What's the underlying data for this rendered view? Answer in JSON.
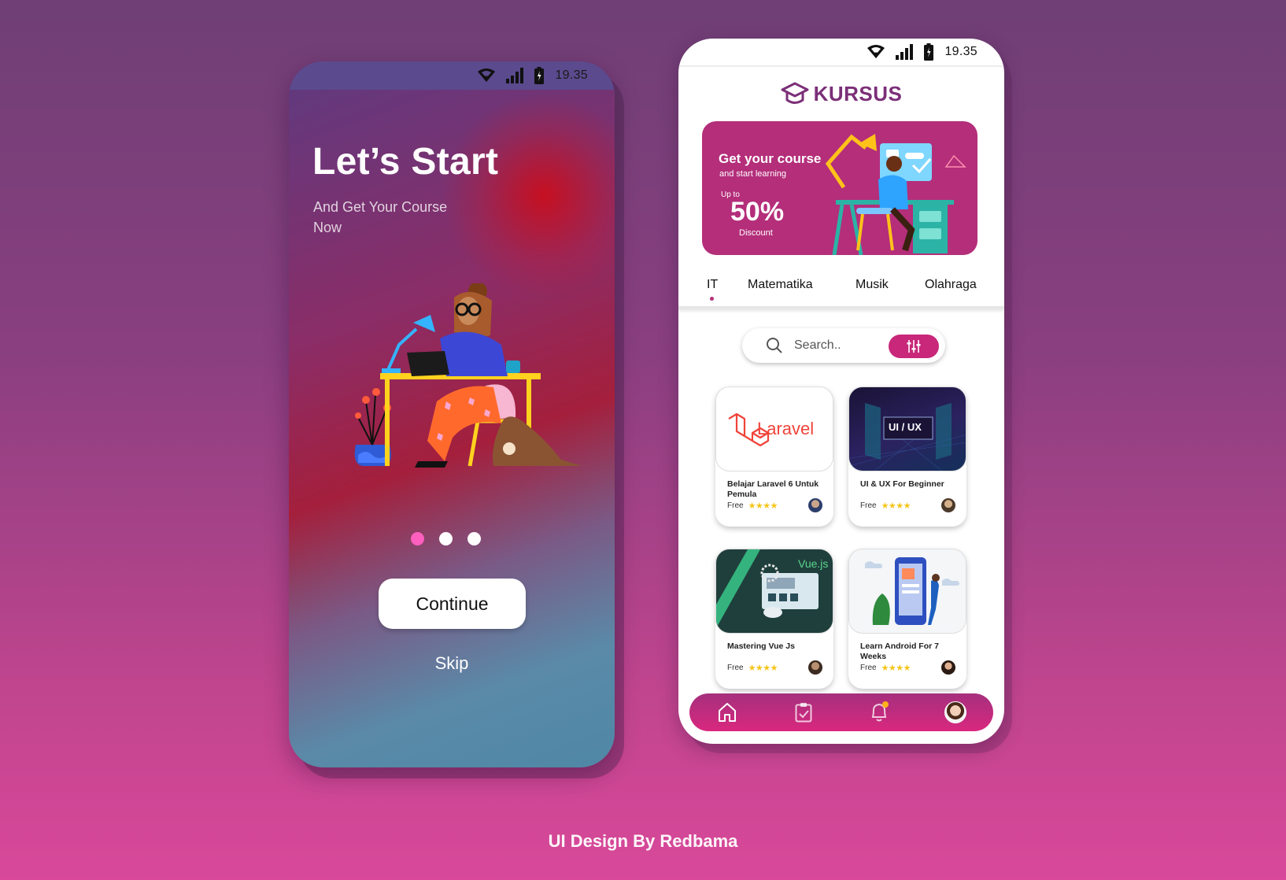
{
  "onboarding": {
    "status": {
      "time": "19.35"
    },
    "title": "Let’s Start",
    "subtitle": "And Get Your Course Now",
    "pagination": {
      "count": 3,
      "active": 1
    },
    "continue_label": "Continue",
    "skip_label": "Skip"
  },
  "home": {
    "status": {
      "time": "19.35"
    },
    "brand": "KURSUS",
    "banner": {
      "headline": "Get your course",
      "subline": "and start learning",
      "upto": "Up to",
      "percent": "50%",
      "discount": "Discount"
    },
    "tabs": [
      {
        "label": "IT",
        "active": true
      },
      {
        "label": "Matematika"
      },
      {
        "label": "Musik"
      },
      {
        "label": "Olahraga"
      }
    ],
    "search": {
      "placeholder": "Search.."
    },
    "courses": [
      {
        "title": "Belajar Laravel 6 Untuk Pemula",
        "price": "Free",
        "stars": "★★★★",
        "thumb_text": "Laravel"
      },
      {
        "title": "UI & UX For Beginner",
        "price": "Free",
        "stars": "★★★★",
        "thumb_text": "UI / UX"
      },
      {
        "title": "Mastering Vue Js",
        "price": "Free",
        "stars": "★★★★",
        "thumb_text": "Vue.js"
      },
      {
        "title": "Learn Android For 7 Weeks",
        "price": "Free",
        "stars": "★★★★"
      }
    ],
    "nav": [
      "home-icon",
      "clipboard-check-icon",
      "bell-icon",
      "profile-avatar"
    ]
  },
  "credit": "UI Design By Redbama",
  "colors": {
    "accent": "#b42e7a",
    "brand": "#7b2f78",
    "dot_active": "#ff5fbe",
    "star": "#f5c518"
  }
}
